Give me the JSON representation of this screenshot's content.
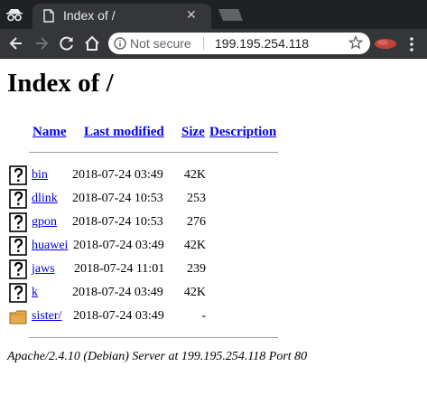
{
  "browser": {
    "tab_title": "Index of /",
    "tab_close": "✕",
    "security_label": "Not secure",
    "url": "199.195.254.118",
    "icons": {
      "incognito": "incognito-icon",
      "favicon": "document-icon",
      "back": "back-arrow-icon",
      "forward": "forward-arrow-icon",
      "reload": "reload-icon",
      "home": "home-icon",
      "info": "info-icon",
      "bookmark": "star-icon",
      "profile": "profile-icon",
      "menu": "kebab-menu-icon"
    }
  },
  "page": {
    "title": "Index of /",
    "columns": {
      "name": "Name",
      "last_modified": "Last modified",
      "size": "Size",
      "description": "Description"
    },
    "entries": [
      {
        "name": "bin",
        "modified": "2018-07-24 03:49",
        "size": "42K",
        "type": "file"
      },
      {
        "name": "dlink",
        "modified": "2018-07-24 10:53",
        "size": "253",
        "type": "file"
      },
      {
        "name": "gpon",
        "modified": "2018-07-24 10:53",
        "size": "276",
        "type": "file"
      },
      {
        "name": "huawei",
        "modified": "2018-07-24 03:49",
        "size": "42K",
        "type": "file"
      },
      {
        "name": "jaws",
        "modified": "2018-07-24 11:01",
        "size": "239",
        "type": "file"
      },
      {
        "name": "k",
        "modified": "2018-07-24 03:49",
        "size": "42K",
        "type": "file"
      },
      {
        "name": "sister/",
        "modified": "2018-07-24 03:49",
        "size": "-",
        "type": "folder"
      }
    ],
    "footer": "Apache/2.4.10 (Debian) Server at 199.195.254.118 Port 80"
  },
  "colors": {
    "link": "#0000ee",
    "chrome_dark": "#202124",
    "tab": "#35363a",
    "folder": "#e8a94a"
  }
}
